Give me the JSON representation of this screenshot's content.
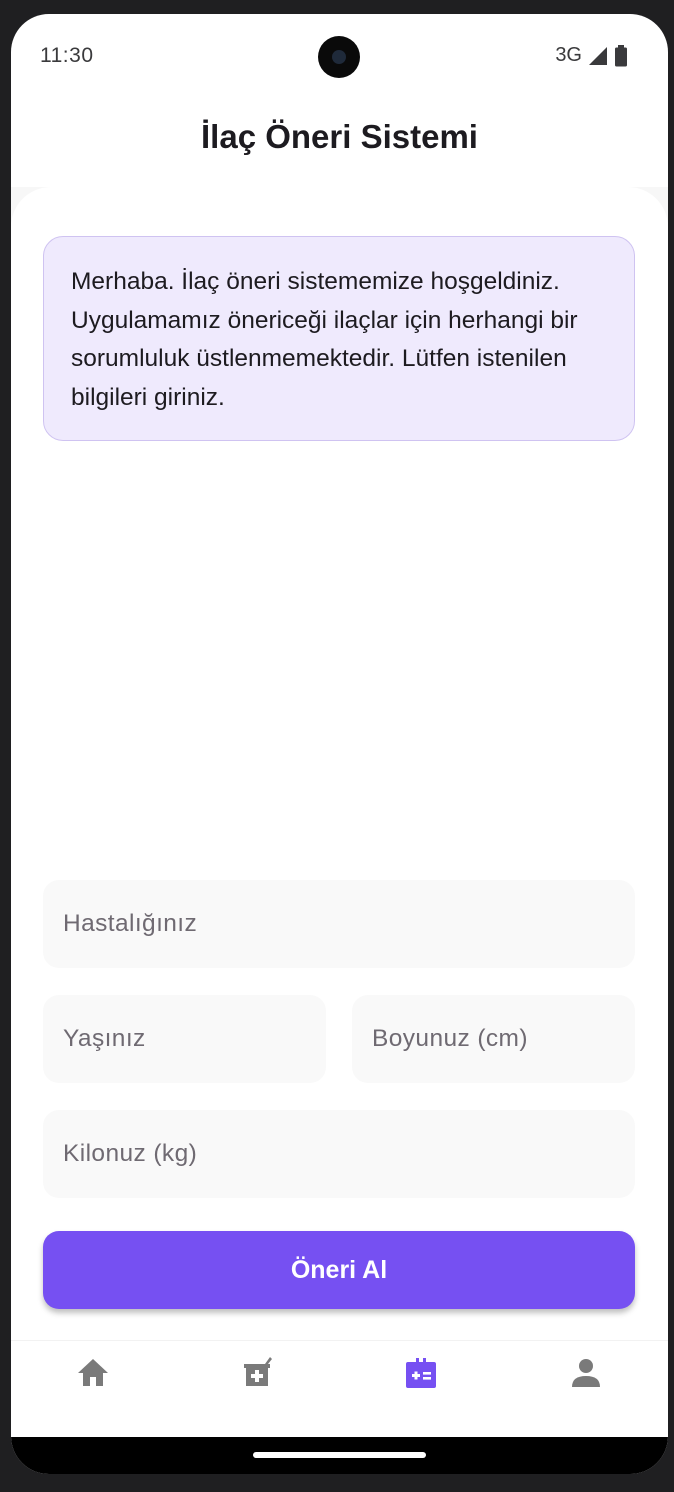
{
  "status_bar": {
    "time": "11:30",
    "network": "3G",
    "signal_icon": "cell-signal-icon",
    "battery_icon": "battery-icon"
  },
  "header": {
    "title": "İlaç Öneri Sistemi"
  },
  "chat": {
    "welcome_message": "Merhaba. İlaç öneri sistememize hoşgeldiniz. Uygulamamız önericeği ilaçlar için herhangi bir sorumluluk üstlenmemektedir. Lütfen istenilen bilgileri giriniz."
  },
  "form": {
    "disease": {
      "placeholder": "Hastalığınız",
      "value": ""
    },
    "age": {
      "placeholder": "Yaşınız",
      "value": ""
    },
    "height": {
      "placeholder": "Boyunuz (cm)",
      "value": ""
    },
    "weight": {
      "placeholder": "Kilonuz (kg)",
      "value": ""
    },
    "submit_label": "Öneri Al"
  },
  "bottom_nav": {
    "items": [
      {
        "icon": "home-icon",
        "active": false
      },
      {
        "icon": "medicine-icon",
        "active": false
      },
      {
        "icon": "medical-advice-icon",
        "active": true
      },
      {
        "icon": "profile-icon",
        "active": false
      }
    ]
  },
  "colors": {
    "accent": "#7650f2",
    "bubble_bg": "#efeafd",
    "bubble_border": "#cfc3f1",
    "nav_inactive": "#7a7a7a",
    "field_bg": "#f9f9f9"
  }
}
